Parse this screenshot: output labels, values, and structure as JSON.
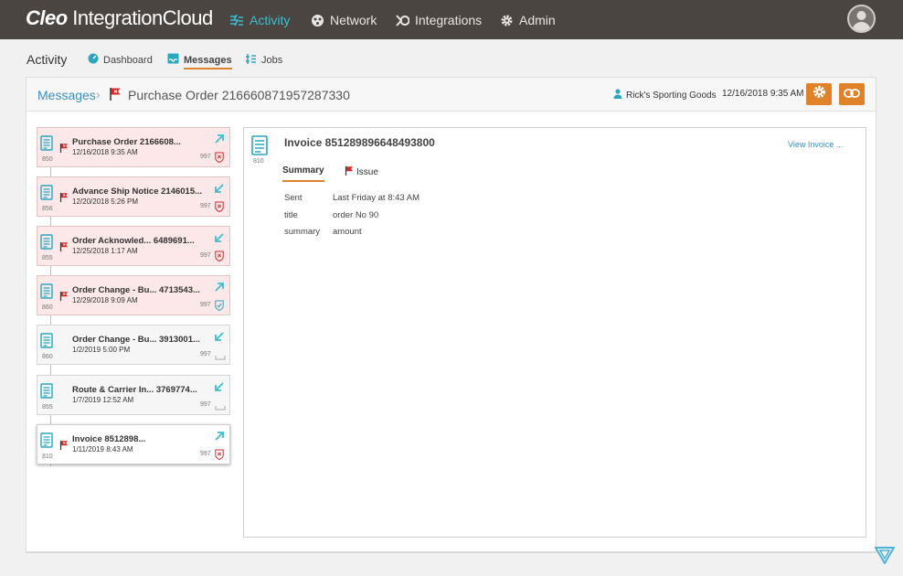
{
  "topbar": {
    "brand_bold": "Cleo",
    "brand_rest": " IntegrationCloud",
    "nav": [
      {
        "label": "Activity",
        "icon": "activity-icon",
        "active": true
      },
      {
        "label": "Network",
        "icon": "network-icon",
        "active": false
      },
      {
        "label": "Integrations",
        "icon": "integrations-icon",
        "active": false
      },
      {
        "label": "Admin",
        "icon": "gear-icon",
        "active": false
      }
    ]
  },
  "subnav": {
    "title": "Activity",
    "items": [
      {
        "label": "Dashboard",
        "icon": "dashboard-icon",
        "active": false
      },
      {
        "label": "Messages",
        "icon": "inbox-icon",
        "active": true
      },
      {
        "label": "Jobs",
        "icon": "jobs-icon",
        "active": false
      }
    ]
  },
  "header": {
    "crumb_root": "Messages",
    "crumb_sep": "›",
    "title": "Purchase Order 216660871957287330",
    "partner": "Rick's Sporting Goods",
    "date": "12/16/2018 9:35 AM"
  },
  "messages": [
    {
      "title": "Purchase Order  2166608...",
      "date": "12/16/2018 9:35 AM",
      "code": "850",
      "ack": "997",
      "flag": true,
      "direction": "out",
      "status": "error"
    },
    {
      "title": "Advance Ship Notice  2146015...",
      "date": "12/20/2018 5:26 PM",
      "code": "856",
      "ack": "997",
      "flag": true,
      "direction": "in",
      "status": "error"
    },
    {
      "title": "Order Acknowled...  6489691...",
      "date": "12/25/2018 1:17 AM",
      "code": "855",
      "ack": "997",
      "flag": true,
      "direction": "in",
      "status": "error"
    },
    {
      "title": "Order Change - Bu...  4713543...",
      "date": "12/29/2018 9:09 AM",
      "code": "860",
      "ack": "997",
      "flag": true,
      "direction": "out",
      "status": "ok"
    },
    {
      "title": "Order Change - Bu...  3913001...",
      "date": "1/2/2019 5:00 PM",
      "code": "860",
      "ack": "997",
      "flag": false,
      "direction": "in",
      "status": "none"
    },
    {
      "title": "Route & Carrier In...  3769774...",
      "date": "1/7/2019 12:52 AM",
      "code": "855",
      "ack": "997",
      "flag": false,
      "direction": "in",
      "status": "none"
    },
    {
      "title": "Invoice  8512898...",
      "date": "1/11/2019 8:43 AM",
      "code": "810",
      "ack": "997",
      "flag": true,
      "direction": "out",
      "status": "error"
    }
  ],
  "detail": {
    "title": "Invoice 851289896648493800",
    "code": "810",
    "link": "View Invoice ...",
    "tabs": [
      {
        "label": "Summary",
        "active": true
      },
      {
        "label": "Issue",
        "active": false
      }
    ],
    "fields": [
      {
        "key": "Sent",
        "value": "Last Friday at 8:43 AM"
      },
      {
        "key": "title",
        "value": "order No 90"
      },
      {
        "key": "summary",
        "value": "amount"
      }
    ]
  },
  "colors": {
    "topbar": "#4a4541",
    "accent_teal": "#3bbfd0",
    "accent_orange": "#e0822a",
    "flag_red": "#d42a2a",
    "link_blue": "#3a8fc0"
  }
}
